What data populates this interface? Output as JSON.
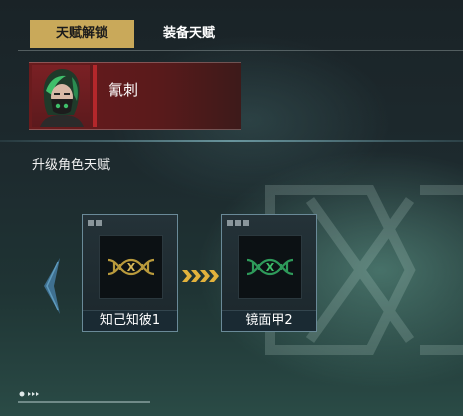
{
  "tabs": [
    {
      "label": "天赋解锁",
      "active": true
    },
    {
      "label": "装备天赋",
      "active": false
    }
  ],
  "hero": {
    "name": "氰刺"
  },
  "section": {
    "title": "升级角色天赋"
  },
  "talents": [
    {
      "name": "知己知彼1",
      "color": "#b99a3c"
    },
    {
      "name": "镜面甲2",
      "color": "#2e9a5a"
    }
  ],
  "colors": {
    "accent": "#c9a95a",
    "hero_bg": "#6a1b1d",
    "hero_bar": "#b3272b",
    "arrow_chevron": "#e2b23c"
  }
}
